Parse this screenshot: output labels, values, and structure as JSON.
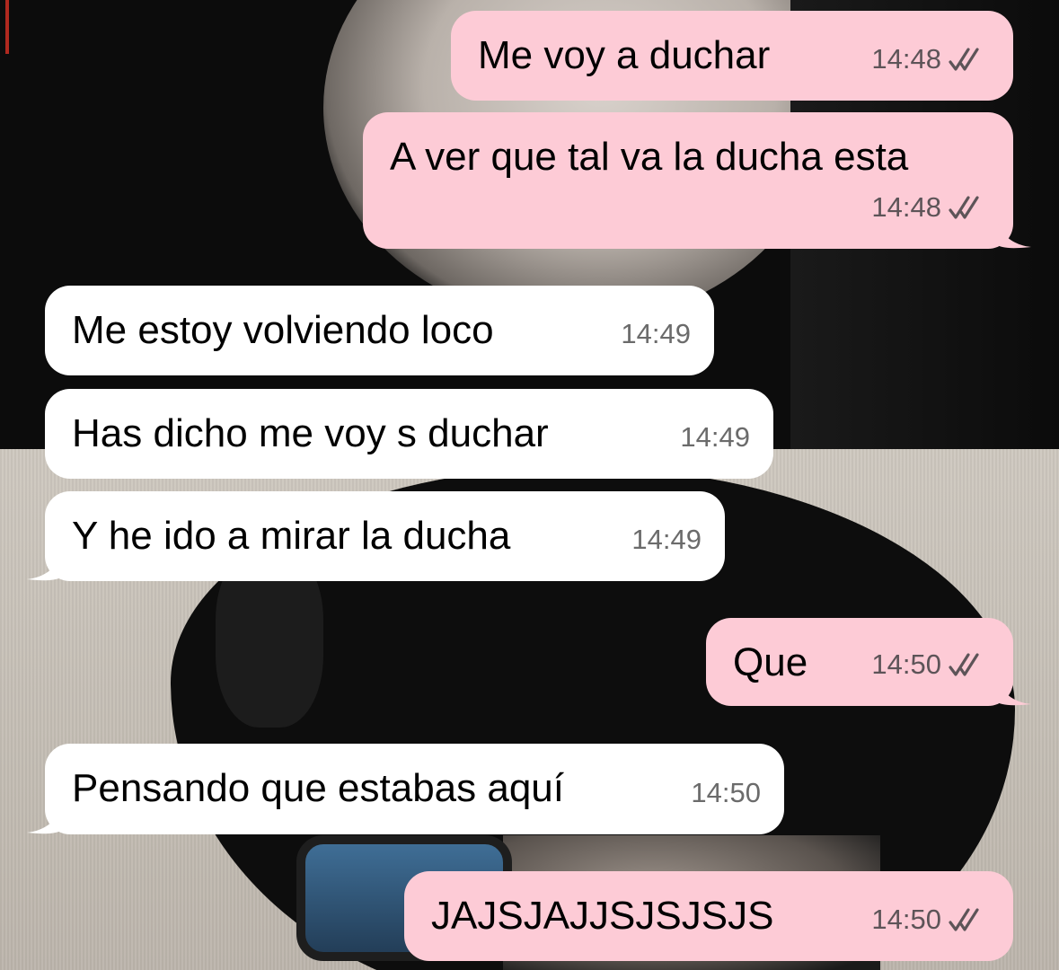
{
  "messages": [
    {
      "dir": "out",
      "text": "Me voy a duchar",
      "time": "14:48",
      "status_icon": "double-check-icon"
    },
    {
      "dir": "out",
      "text": "A ver que tal va la ducha esta",
      "time": "14:48",
      "status_icon": "double-check-icon"
    },
    {
      "dir": "in",
      "text": "Me estoy volviendo loco",
      "time": "14:49"
    },
    {
      "dir": "in",
      "text": "Has dicho me voy s duchar",
      "time": "14:49"
    },
    {
      "dir": "in",
      "text": "Y he ido a mirar la ducha",
      "time": "14:49"
    },
    {
      "dir": "out",
      "text": "Que",
      "time": "14:50",
      "status_icon": "double-check-icon"
    },
    {
      "dir": "in",
      "text": "Pensando que estabas aquí",
      "time": "14:50"
    },
    {
      "dir": "out",
      "text": "JAJSJAJJSJSJSJS",
      "time": "14:50",
      "status_icon": "double-check-icon"
    }
  ],
  "colors": {
    "outgoing_bubble": "#fdcbd6",
    "incoming_bubble": "#ffffff",
    "timestamp": "#5d5458"
  }
}
